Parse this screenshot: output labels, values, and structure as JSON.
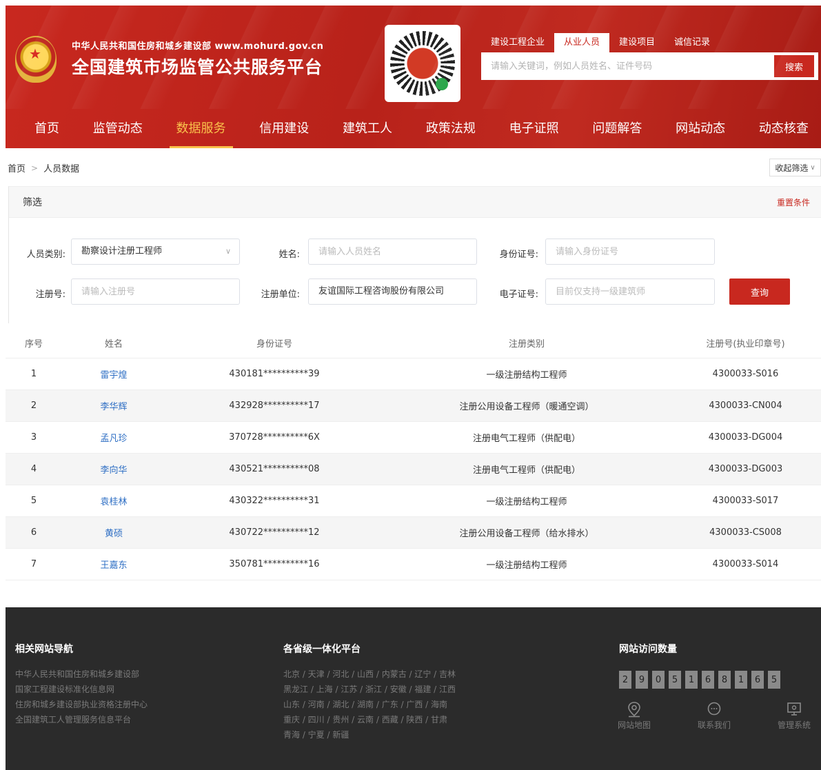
{
  "header": {
    "sub_title": "中华人民共和国住房和城乡建设部  www.mohurd.gov.cn",
    "main_title": "全国建筑市场监管公共服务平台",
    "search_tabs": [
      "建设工程企业",
      "从业人员",
      "建设项目",
      "诚信记录"
    ],
    "active_search_tab": "从业人员",
    "search_placeholder": "请输入关键词，例如人员姓名、证件号码",
    "search_button": "搜索"
  },
  "nav": {
    "items": [
      "首页",
      "监管动态",
      "数据服务",
      "信用建设",
      "建筑工人",
      "政策法规",
      "电子证照",
      "问题解答",
      "网站动态",
      "动态核查"
    ],
    "active": "数据服务"
  },
  "breadcrumb": {
    "home": "首页",
    "current": "人员数据"
  },
  "collapse_label": "收起筛选",
  "filter": {
    "title": "筛选",
    "reset": "重置条件",
    "person_type_label": "人员类别:",
    "person_type_value": "勘察设计注册工程师",
    "name_label": "姓名:",
    "name_placeholder": "请输入人员姓名",
    "id_label": "身份证号:",
    "id_placeholder": "请输入身份证号",
    "reg_label": "注册号:",
    "reg_placeholder": "请输入注册号",
    "unit_label": "注册单位:",
    "unit_value": "友谊国际工程咨询股份有限公司",
    "ecert_label": "电子证号:",
    "ecert_placeholder": "目前仅支持一级建筑师",
    "query_button": "查询"
  },
  "table": {
    "headers": [
      "序号",
      "姓名",
      "身份证号",
      "注册类别",
      "注册号(执业印章号)"
    ],
    "rows": [
      {
        "no": "1",
        "name": "雷宇煌",
        "id": "430181**********39",
        "type": "一级注册结构工程师",
        "reg": "4300033-S016"
      },
      {
        "no": "2",
        "name": "李华辉",
        "id": "432928**********17",
        "type": "注册公用设备工程师（暖通空调）",
        "reg": "4300033-CN004"
      },
      {
        "no": "3",
        "name": "孟凡珍",
        "id": "370728**********6X",
        "type": "注册电气工程师（供配电）",
        "reg": "4300033-DG004"
      },
      {
        "no": "4",
        "name": "李向华",
        "id": "430521**********08",
        "type": "注册电气工程师（供配电）",
        "reg": "4300033-DG003"
      },
      {
        "no": "5",
        "name": "袁桂林",
        "id": "430322**********31",
        "type": "一级注册结构工程师",
        "reg": "4300033-S017"
      },
      {
        "no": "6",
        "name": "黄硕",
        "id": "430722**********12",
        "type": "注册公用设备工程师（给水排水）",
        "reg": "4300033-CS008"
      },
      {
        "no": "7",
        "name": "王嘉东",
        "id": "350781**********16",
        "type": "一级注册结构工程师",
        "reg": "4300033-S014"
      }
    ]
  },
  "footer": {
    "nav_title": "相关网站导航",
    "nav_links": [
      "中华人民共和国住房和城乡建设部",
      "国家工程建设标准化信息网",
      "住房和城乡建设部执业资格注册中心",
      "全国建筑工人管理服务信息平台"
    ],
    "prov_title": "各省级一体化平台",
    "prov_lines": [
      "北京 / 天津 / 河北 / 山西 / 内蒙古 / 辽宁 / 吉林",
      "黑龙江 / 上海 / 江苏 / 浙江 / 安徽 / 福建 / 江西",
      "山东 / 河南 / 湖北 / 湖南 / 广东 / 广西 / 海南",
      "重庆 / 四川 / 贵州 / 云南 / 西藏 / 陕西 / 甘肃",
      "青海 / 宁夏 / 新疆"
    ],
    "visit_title": "网站访问数量",
    "visit_digits": [
      "2",
      "9",
      "0",
      "5",
      "1",
      "6",
      "8",
      "1",
      "6",
      "5"
    ],
    "icons": [
      {
        "label": "网站地图",
        "icon": "map-pin-icon"
      },
      {
        "label": "联系我们",
        "icon": "chat-icon"
      },
      {
        "label": "管理系统",
        "icon": "monitor-icon"
      }
    ]
  },
  "colors": {
    "brand_red": "#c8281f",
    "nav_active": "#f9c24c",
    "link_blue": "#2f6fc4",
    "footer_bg": "#2b2b2b"
  }
}
